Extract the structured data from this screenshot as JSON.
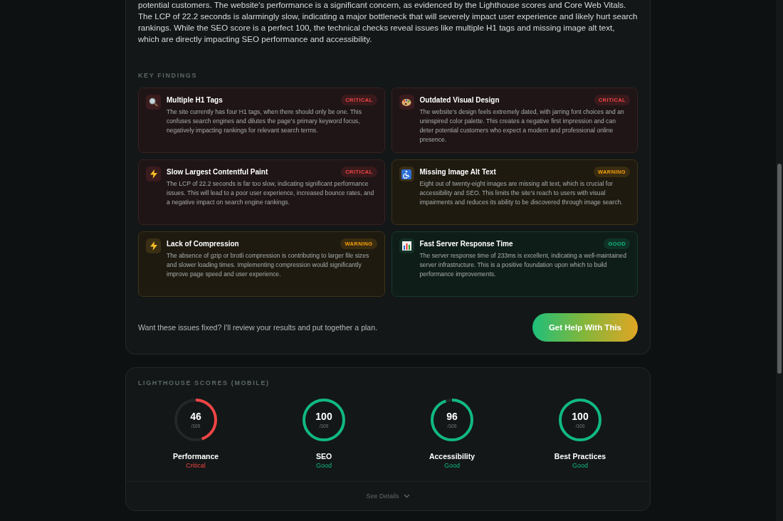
{
  "summary": "potential customers. The website's performance is a significant concern, as evidenced by the Lighthouse scores and Core Web Vitals. The LCP of 22.2 seconds is alarmingly slow, indicating a major bottleneck that will severely impact user experience and likely hurt search rankings. While the SEO score is a perfect 100, the technical checks reveal issues like multiple H1 tags and missing image alt text, which are directly impacting SEO performance and accessibility.",
  "findings_title": "KEY FINDINGS",
  "findings": [
    {
      "kind": "critical",
      "title": "Multiple H1 Tags",
      "badge": "CRITICAL",
      "text": "The site currently has four H1 tags, when there should only be one. This confuses search engines and dilutes the page's primary keyword focus, negatively impacting rankings for relevant search terms."
    },
    {
      "kind": "critical",
      "title": "Outdated Visual Design",
      "badge": "CRITICAL",
      "text": "The website's design feels extremely dated, with jarring font choices and an uninspired color palette. This creates a negative first impression and can deter potential customers who expect a modern and professional online presence."
    },
    {
      "kind": "critical",
      "title": "Slow Largest Contentful Paint",
      "badge": "CRITICAL",
      "text": "The LCP of 22.2 seconds is far too slow, indicating significant performance issues. This will lead to a poor user experience, increased bounce rates, and a negative impact on search engine rankings."
    },
    {
      "kind": "warning",
      "title": "Missing Image Alt Text",
      "badge": "WARNING",
      "text": "Eight out of twenty-eight images are missing alt text, which is crucial for accessibility and SEO. This limits the site's reach to users with visual impairments and reduces its ability to be discovered through image search."
    },
    {
      "kind": "warning",
      "title": "Lack of Compression",
      "badge": "WARNING",
      "text": "The absence of gzip or brotli compression is contributing to larger file sizes and slower loading times. Implementing compression would significantly improve page speed and user experience."
    },
    {
      "kind": "good",
      "title": "Fast Server Response Time",
      "badge": "GOOD",
      "text": "The server response time of 233ms is excellent, indicating a well-maintained server infrastructure. This is a positive foundation upon which to build performance improvements."
    }
  ],
  "cta": {
    "text": "Want these issues fixed? I'll review your results and put together a plan.",
    "button": "Get Help With This"
  },
  "lighthouse": {
    "title": "LIGHTHOUSE SCORES (MOBILE)",
    "scores": [
      {
        "kind": "critical",
        "score": "46",
        "max": "/100",
        "level": 0.46,
        "label": "Performance",
        "status": "Critical"
      },
      {
        "kind": "good",
        "score": "100",
        "max": "/100",
        "level": 1,
        "label": "SEO",
        "status": "Good"
      },
      {
        "kind": "good",
        "score": "96",
        "max": "/100",
        "level": 0.96,
        "label": "Accessibility",
        "status": "Good"
      },
      {
        "kind": "good",
        "score": "100",
        "max": "/100",
        "level": 1,
        "label": "Best Practices",
        "status": "Good"
      }
    ],
    "details": "See Details"
  }
}
